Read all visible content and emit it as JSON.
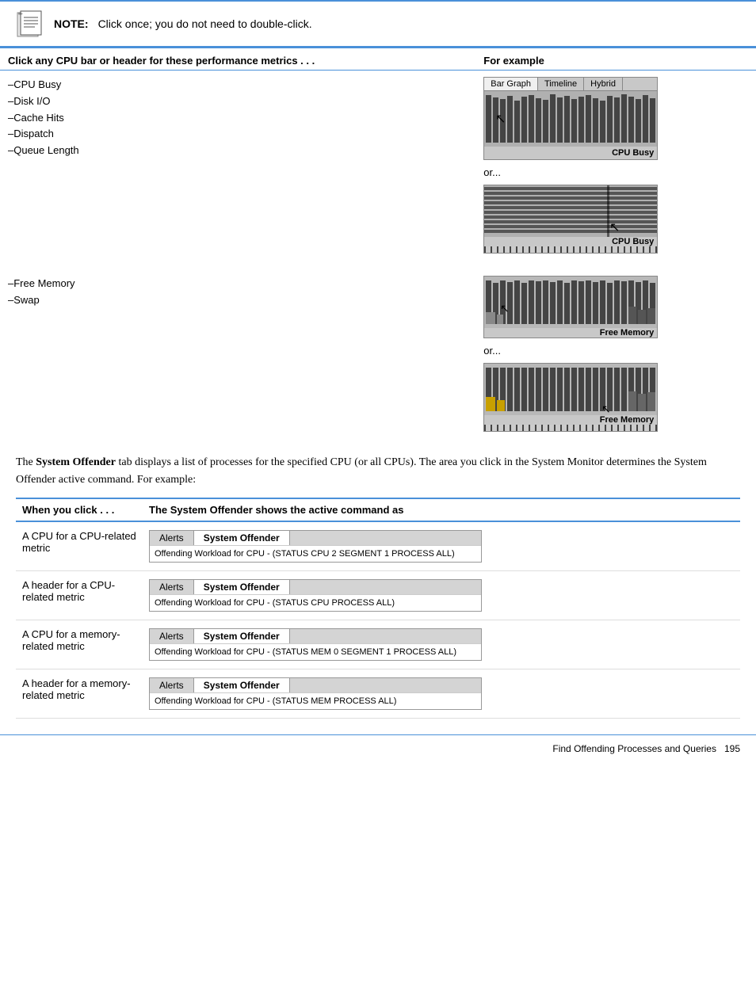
{
  "note": {
    "text": "NOTE:",
    "body": "Click once; you do not need to double-click."
  },
  "cpu_section": {
    "header_col1": "Click any CPU bar or header for these performance metrics . . .",
    "header_col2": "For example",
    "metrics_cpu": [
      "–CPU Busy",
      "–Disk I/O",
      "–Cache Hits",
      "–Dispatch",
      "–Queue Length"
    ],
    "metrics_memory": [
      "–Free Memory",
      "–Swap"
    ],
    "or_text": "or...",
    "chart_tabs": [
      "Bar Graph",
      "Timeline",
      "Hybrid"
    ],
    "cpu_busy_label": "CPU Busy",
    "free_memory_label": "Free Memory"
  },
  "system_offender_paragraph": {
    "prefix": "The ",
    "bold": "System Offender",
    "suffix": " tab displays a list of processes for the specified CPU (or all CPUs). The area you click in the System Monitor determines the System Offender active command. For example:"
  },
  "offender_table": {
    "col1_header": "When you click . . .",
    "col2_header": "The System Offender shows the active command as",
    "rows": [
      {
        "when": "A CPU for a CPU-related metric",
        "tab_labels": [
          "Alerts",
          "System Offender"
        ],
        "command": "Offending Workload for CPU - (STATUS CPU 2 SEGMENT 1 PROCESS ALL)"
      },
      {
        "when": "A header for a CPU-related metric",
        "tab_labels": [
          "Alerts",
          "System Offender"
        ],
        "command": "Offending Workload for CPU - (STATUS CPU PROCESS ALL)"
      },
      {
        "when": "A CPU for a memory-related metric",
        "tab_labels": [
          "Alerts",
          "System Offender"
        ],
        "command": "Offending Workload for CPU - (STATUS MEM 0 SEGMENT 1 PROCESS ALL)"
      },
      {
        "when": "A header for a memory-related metric",
        "tab_labels": [
          "Alerts",
          "System Offender"
        ],
        "command": "Offending Workload for CPU - (STATUS MEM PROCESS ALL)"
      }
    ]
  },
  "footer": {
    "text": "Find Offending Processes and Queries",
    "page": "195"
  }
}
